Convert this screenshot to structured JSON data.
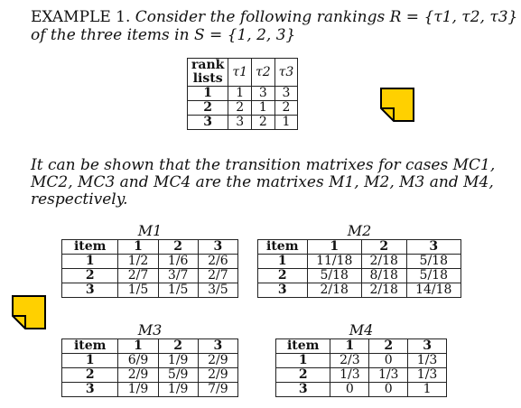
{
  "example_header": {
    "label": "EXAMPLE 1.",
    "line1": "Consider the following rankings R = {τ1, τ2, τ3}",
    "line2": "of the three items in S = {1, 2, 3}"
  },
  "rank_table": {
    "header_col": "rank\nlists",
    "columns": [
      "τ1",
      "τ2",
      "τ3"
    ],
    "rows": [
      {
        "label": "1",
        "values": [
          "1",
          "3",
          "3"
        ]
      },
      {
        "label": "2",
        "values": [
          "2",
          "1",
          "2"
        ]
      },
      {
        "label": "3",
        "values": [
          "3",
          "2",
          "1"
        ]
      }
    ]
  },
  "paragraph": {
    "line1": "It can be shown that the transition matrixes for cases MC1,",
    "line2": "MC2, MC3 and MC4 are the matrixes M1, M2, M3 and M4,",
    "line3": "respectively."
  },
  "matrices": [
    {
      "title": "M1",
      "columns": [
        "item",
        "1",
        "2",
        "3"
      ],
      "rows": [
        [
          "1",
          "1/2",
          "1/6",
          "2/6"
        ],
        [
          "2",
          "2/7",
          "3/7",
          "2/7"
        ],
        [
          "3",
          "1/5",
          "1/5",
          "3/5"
        ]
      ]
    },
    {
      "title": "M2",
      "columns": [
        "item",
        "1",
        "2",
        "3"
      ],
      "rows": [
        [
          "1",
          "11/18",
          "2/18",
          "5/18"
        ],
        [
          "2",
          "5/18",
          "8/18",
          "5/18"
        ],
        [
          "3",
          "2/18",
          "2/18",
          "14/18"
        ]
      ]
    },
    {
      "title": "M3",
      "columns": [
        "item",
        "1",
        "2",
        "3"
      ],
      "rows": [
        [
          "1",
          "6/9",
          "1/9",
          "2/9"
        ],
        [
          "2",
          "2/9",
          "5/9",
          "2/9"
        ],
        [
          "3",
          "1/9",
          "1/9",
          "7/9"
        ]
      ]
    },
    {
      "title": "M4",
      "columns": [
        "item",
        "1",
        "2",
        "3"
      ],
      "rows": [
        [
          "1",
          "2/3",
          "0",
          "1/3"
        ],
        [
          "2",
          "1/3",
          "1/3",
          "1/3"
        ],
        [
          "3",
          "0",
          "0",
          "1"
        ]
      ]
    }
  ],
  "colors": {
    "note_fill": "#FFD000",
    "note_stroke": "#000000"
  },
  "icons": [
    "sticky-note-icon",
    "sticky-note-icon"
  ]
}
